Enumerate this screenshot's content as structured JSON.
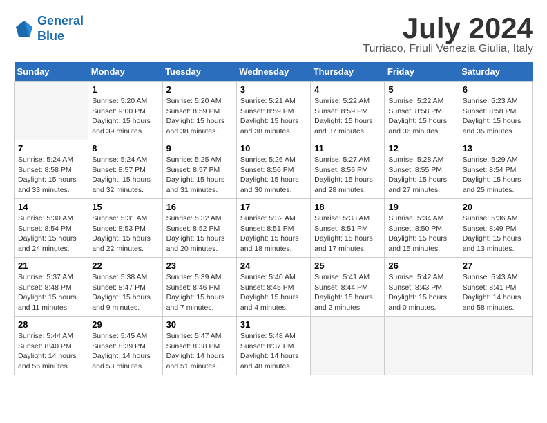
{
  "header": {
    "logo_line1": "General",
    "logo_line2": "Blue",
    "month_title": "July 2024",
    "location": "Turriaco, Friuli Venezia Giulia, Italy"
  },
  "days_of_week": [
    "Sunday",
    "Monday",
    "Tuesday",
    "Wednesday",
    "Thursday",
    "Friday",
    "Saturday"
  ],
  "weeks": [
    [
      {
        "day": null
      },
      {
        "day": 1,
        "sunrise": "5:20 AM",
        "sunset": "9:00 PM",
        "daylight": "15 hours and 39 minutes."
      },
      {
        "day": 2,
        "sunrise": "5:20 AM",
        "sunset": "8:59 PM",
        "daylight": "15 hours and 38 minutes."
      },
      {
        "day": 3,
        "sunrise": "5:21 AM",
        "sunset": "8:59 PM",
        "daylight": "15 hours and 38 minutes."
      },
      {
        "day": 4,
        "sunrise": "5:22 AM",
        "sunset": "8:59 PM",
        "daylight": "15 hours and 37 minutes."
      },
      {
        "day": 5,
        "sunrise": "5:22 AM",
        "sunset": "8:58 PM",
        "daylight": "15 hours and 36 minutes."
      },
      {
        "day": 6,
        "sunrise": "5:23 AM",
        "sunset": "8:58 PM",
        "daylight": "15 hours and 35 minutes."
      }
    ],
    [
      {
        "day": 7,
        "sunrise": "5:24 AM",
        "sunset": "8:58 PM",
        "daylight": "15 hours and 33 minutes."
      },
      {
        "day": 8,
        "sunrise": "5:24 AM",
        "sunset": "8:57 PM",
        "daylight": "15 hours and 32 minutes."
      },
      {
        "day": 9,
        "sunrise": "5:25 AM",
        "sunset": "8:57 PM",
        "daylight": "15 hours and 31 minutes."
      },
      {
        "day": 10,
        "sunrise": "5:26 AM",
        "sunset": "8:56 PM",
        "daylight": "15 hours and 30 minutes."
      },
      {
        "day": 11,
        "sunrise": "5:27 AM",
        "sunset": "8:56 PM",
        "daylight": "15 hours and 28 minutes."
      },
      {
        "day": 12,
        "sunrise": "5:28 AM",
        "sunset": "8:55 PM",
        "daylight": "15 hours and 27 minutes."
      },
      {
        "day": 13,
        "sunrise": "5:29 AM",
        "sunset": "8:54 PM",
        "daylight": "15 hours and 25 minutes."
      }
    ],
    [
      {
        "day": 14,
        "sunrise": "5:30 AM",
        "sunset": "8:54 PM",
        "daylight": "15 hours and 24 minutes."
      },
      {
        "day": 15,
        "sunrise": "5:31 AM",
        "sunset": "8:53 PM",
        "daylight": "15 hours and 22 minutes."
      },
      {
        "day": 16,
        "sunrise": "5:32 AM",
        "sunset": "8:52 PM",
        "daylight": "15 hours and 20 minutes."
      },
      {
        "day": 17,
        "sunrise": "5:32 AM",
        "sunset": "8:51 PM",
        "daylight": "15 hours and 18 minutes."
      },
      {
        "day": 18,
        "sunrise": "5:33 AM",
        "sunset": "8:51 PM",
        "daylight": "15 hours and 17 minutes."
      },
      {
        "day": 19,
        "sunrise": "5:34 AM",
        "sunset": "8:50 PM",
        "daylight": "15 hours and 15 minutes."
      },
      {
        "day": 20,
        "sunrise": "5:36 AM",
        "sunset": "8:49 PM",
        "daylight": "15 hours and 13 minutes."
      }
    ],
    [
      {
        "day": 21,
        "sunrise": "5:37 AM",
        "sunset": "8:48 PM",
        "daylight": "15 hours and 11 minutes."
      },
      {
        "day": 22,
        "sunrise": "5:38 AM",
        "sunset": "8:47 PM",
        "daylight": "15 hours and 9 minutes."
      },
      {
        "day": 23,
        "sunrise": "5:39 AM",
        "sunset": "8:46 PM",
        "daylight": "15 hours and 7 minutes."
      },
      {
        "day": 24,
        "sunrise": "5:40 AM",
        "sunset": "8:45 PM",
        "daylight": "15 hours and 4 minutes."
      },
      {
        "day": 25,
        "sunrise": "5:41 AM",
        "sunset": "8:44 PM",
        "daylight": "15 hours and 2 minutes."
      },
      {
        "day": 26,
        "sunrise": "5:42 AM",
        "sunset": "8:43 PM",
        "daylight": "15 hours and 0 minutes."
      },
      {
        "day": 27,
        "sunrise": "5:43 AM",
        "sunset": "8:41 PM",
        "daylight": "14 hours and 58 minutes."
      }
    ],
    [
      {
        "day": 28,
        "sunrise": "5:44 AM",
        "sunset": "8:40 PM",
        "daylight": "14 hours and 56 minutes."
      },
      {
        "day": 29,
        "sunrise": "5:45 AM",
        "sunset": "8:39 PM",
        "daylight": "14 hours and 53 minutes."
      },
      {
        "day": 30,
        "sunrise": "5:47 AM",
        "sunset": "8:38 PM",
        "daylight": "14 hours and 51 minutes."
      },
      {
        "day": 31,
        "sunrise": "5:48 AM",
        "sunset": "8:37 PM",
        "daylight": "14 hours and 48 minutes."
      },
      {
        "day": null
      },
      {
        "day": null
      },
      {
        "day": null
      }
    ]
  ]
}
